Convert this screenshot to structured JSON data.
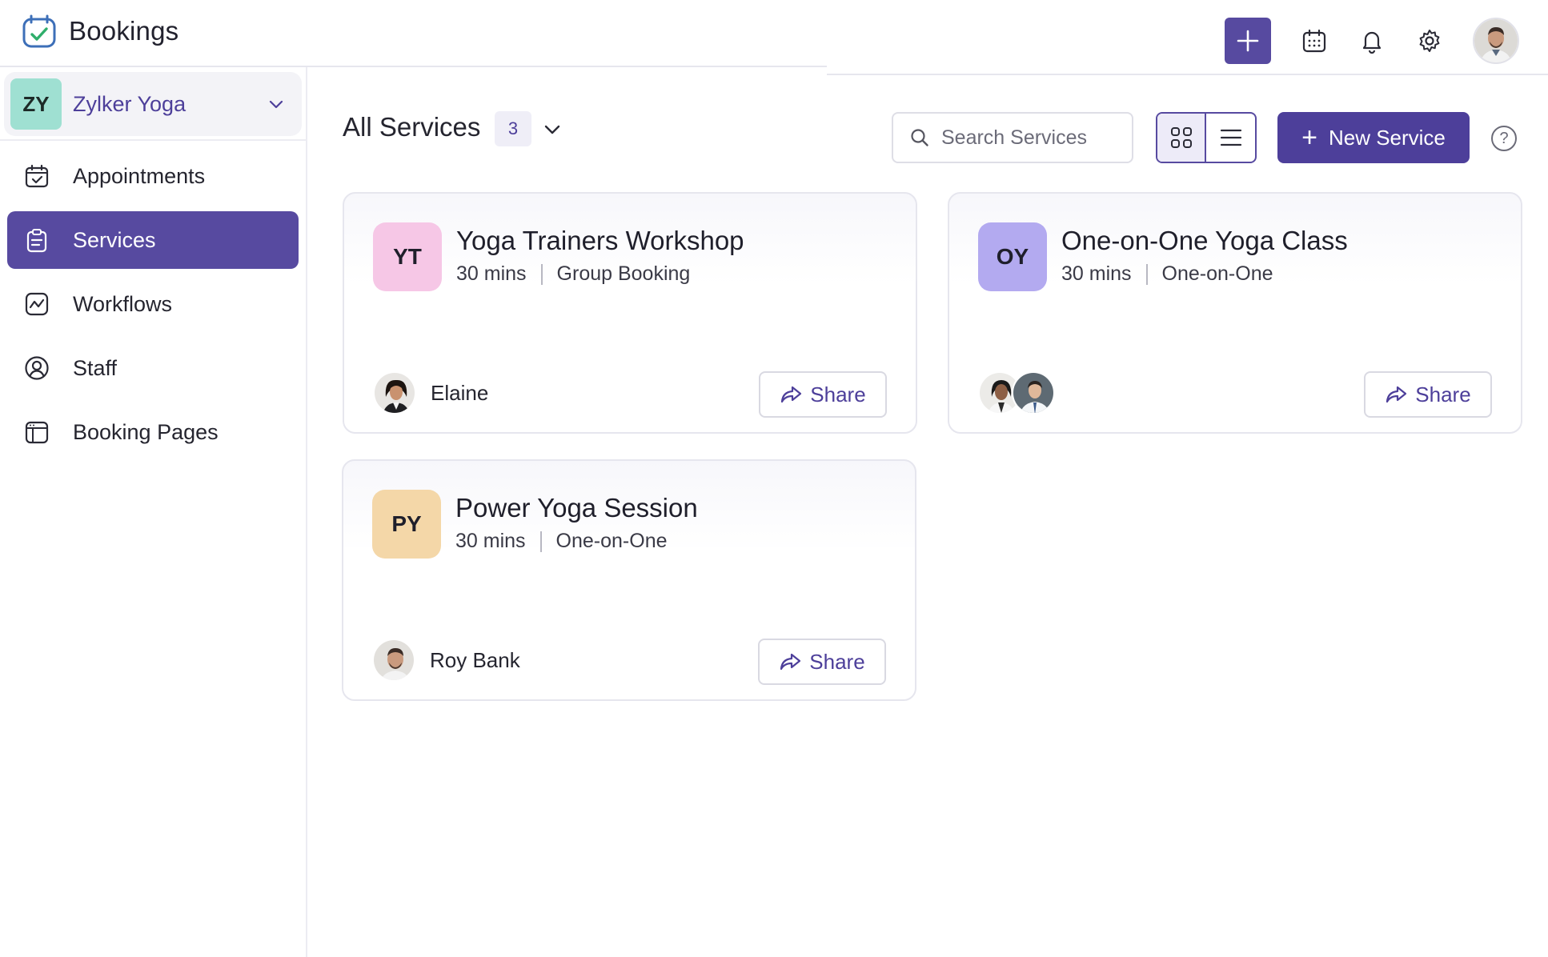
{
  "app": {
    "name": "Bookings"
  },
  "top_actions": {
    "icons": [
      "plus-icon",
      "calendar-icon",
      "bell-icon",
      "gear-icon"
    ]
  },
  "workspace": {
    "initials": "ZY",
    "name": "Zylker Yoga",
    "badge_color": "#9fe0d2"
  },
  "sidebar": {
    "items": [
      {
        "label": "Appointments",
        "icon": "calendar-check-icon",
        "active": false
      },
      {
        "label": "Services",
        "icon": "clipboard-icon",
        "active": true
      },
      {
        "label": "Workflows",
        "icon": "workflow-icon",
        "active": false
      },
      {
        "label": "Staff",
        "icon": "user-circle-icon",
        "active": false
      },
      {
        "label": "Booking Pages",
        "icon": "booking-page-icon",
        "active": false
      }
    ]
  },
  "header": {
    "title": "All Services",
    "count": "3",
    "search_placeholder": "Search Services",
    "new_service_label": "New Service",
    "help_label": "?"
  },
  "services": [
    {
      "initials": "YT",
      "name": "Yoga Trainers Workshop",
      "duration": "30 mins",
      "type": "Group Booking",
      "staff": "Elaine",
      "badge_color": "#f6c7e6",
      "share_label": "Share"
    },
    {
      "initials": "OY",
      "name": "One-on-One Yoga Class",
      "duration": "30 mins",
      "type": "One-on-One",
      "staff": "",
      "badge_color": "#b3aaf0",
      "share_label": "Share"
    },
    {
      "initials": "PY",
      "name": "Power Yoga Session",
      "duration": "30 mins",
      "type": "One-on-One",
      "staff": "Roy Bank",
      "badge_color": "#f4d7a8",
      "share_label": "Share"
    }
  ],
  "colors": {
    "accent": "#574aa0",
    "accent_dark": "#4d3f9a"
  }
}
